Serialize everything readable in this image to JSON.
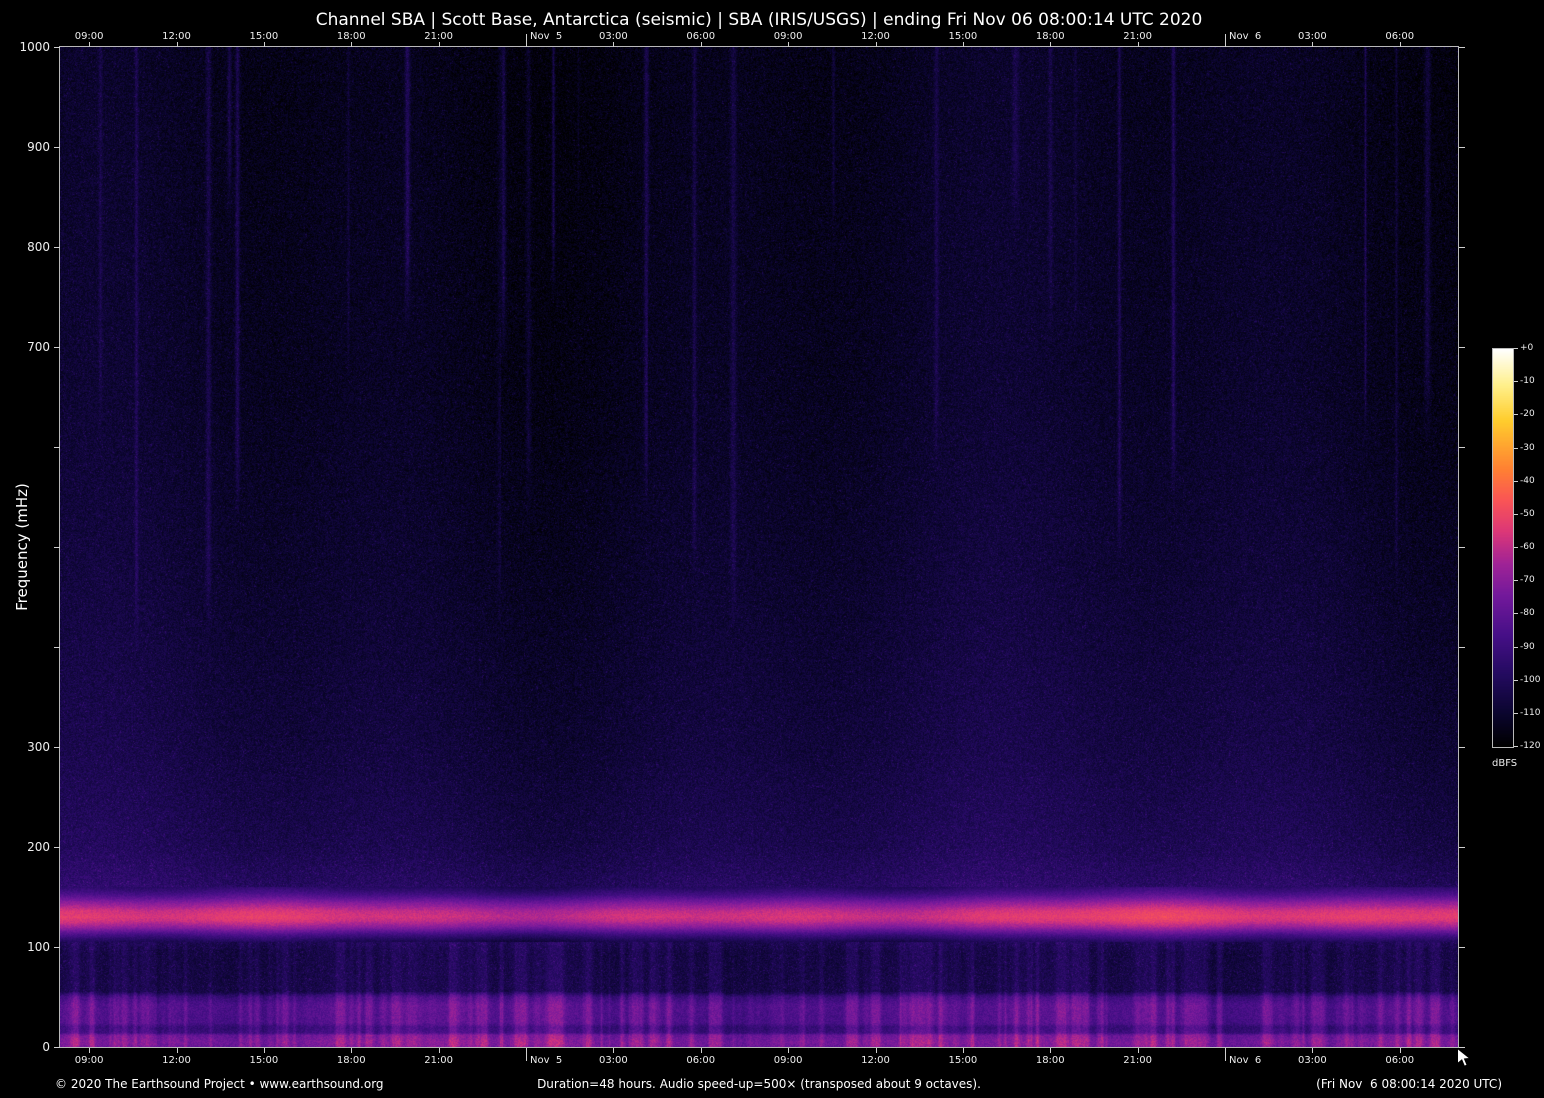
{
  "title": "Channel SBA | Scott Base, Antarctica (seismic) | SBA (IRIS/USGS) | ending Fri Nov 06 08:00:14 UTC 2020",
  "footer": {
    "copyright": "© 2020 The Earthsound Project • www.earthsound.org",
    "duration": "Duration=48 hours. Audio speed-up=500× (transposed about 9 octaves).",
    "timestamp": "(Fri Nov  6 08:00:14 2020 UTC)"
  },
  "colors": {
    "background": "#000000",
    "text": "#ffffff",
    "axis": "#c8c8c8"
  },
  "chart_data": {
    "type": "heatmap",
    "subtype": "audio-spectrogram",
    "title": "Channel SBA | Scott Base, Antarctica (seismic) | SBA (IRIS/USGS) | ending Fri Nov 06 08:00:14 UTC 2020",
    "xlabel": "",
    "ylabel": "Frequency (mHz)",
    "ylim": [
      0,
      1000
    ],
    "duration_hours": 48,
    "x_span_hours": 48,
    "x_ticks": [
      {
        "label": "09:00",
        "hour": 1
      },
      {
        "label": "12:00",
        "hour": 4
      },
      {
        "label": "15:00",
        "hour": 7
      },
      {
        "label": "18:00",
        "hour": 10
      },
      {
        "label": "21:00",
        "hour": 13
      },
      {
        "label": "Nov  5",
        "hour": 16,
        "date": true
      },
      {
        "label": "03:00",
        "hour": 19
      },
      {
        "label": "06:00",
        "hour": 22
      },
      {
        "label": "09:00",
        "hour": 25
      },
      {
        "label": "12:00",
        "hour": 28
      },
      {
        "label": "15:00",
        "hour": 31
      },
      {
        "label": "18:00",
        "hour": 34
      },
      {
        "label": "21:00",
        "hour": 37
      },
      {
        "label": "Nov  6",
        "hour": 40,
        "date": true
      },
      {
        "label": "03:00",
        "hour": 43
      },
      {
        "label": "06:00",
        "hour": 46
      }
    ],
    "y_ticks": [
      {
        "value": 1000,
        "label": "1000"
      },
      {
        "value": 900,
        "label": "900"
      },
      {
        "value": 800,
        "label": "800"
      },
      {
        "value": 700,
        "label": "700"
      },
      {
        "value": 600,
        "label": ""
      },
      {
        "value": 500,
        "label": ""
      },
      {
        "value": 400,
        "label": ""
      },
      {
        "value": 300,
        "label": "300"
      },
      {
        "value": 200,
        "label": "200"
      },
      {
        "value": 100,
        "label": "100"
      },
      {
        "value": 0,
        "label": "0"
      }
    ],
    "colorbar": {
      "unit": "dBFS",
      "max_dbfs": 0,
      "min_dbfs": -120,
      "tick_labels": [
        "+0",
        "-10",
        "-20",
        "-30",
        "-40",
        "-50",
        "-60",
        "-70",
        "-80",
        "-90",
        "-100",
        "-110",
        "-120"
      ],
      "gradient_stops": [
        {
          "v": 0.0,
          "c": "#000000"
        },
        {
          "v": 0.08,
          "c": "#0a052d"
        },
        {
          "v": 0.18,
          "c": "#230a5f"
        },
        {
          "v": 0.28,
          "c": "#460f87"
        },
        {
          "v": 0.38,
          "c": "#73199b"
        },
        {
          "v": 0.46,
          "c": "#a02396"
        },
        {
          "v": 0.54,
          "c": "#dc3778"
        },
        {
          "v": 0.62,
          "c": "#fa5555"
        },
        {
          "v": 0.7,
          "c": "#ff8232"
        },
        {
          "v": 0.82,
          "c": "#ffcd2d"
        },
        {
          "v": 0.91,
          "c": "#fff08c"
        },
        {
          "v": 1.0,
          "c": "#ffffff"
        }
      ]
    },
    "profile_dbfs": [
      [
        0,
        -76
      ],
      [
        5,
        -74
      ],
      [
        12,
        -78
      ],
      [
        14,
        -90
      ],
      [
        20,
        -92
      ],
      [
        24,
        -85
      ],
      [
        42,
        -84
      ],
      [
        50,
        -90
      ],
      [
        55,
        -104
      ],
      [
        95,
        -105
      ],
      [
        105,
        -102
      ],
      [
        112,
        -88
      ],
      [
        120,
        -68
      ],
      [
        126,
        -58
      ],
      [
        130,
        -55
      ],
      [
        136,
        -58
      ],
      [
        144,
        -70
      ],
      [
        152,
        -86
      ],
      [
        160,
        -97
      ],
      [
        200,
        -102
      ],
      [
        300,
        -106
      ],
      [
        450,
        -109
      ],
      [
        650,
        -112
      ],
      [
        1000,
        -114
      ]
    ],
    "features": {
      "bands": [
        {
          "freq_mhz": [
            110,
            160
          ],
          "peak_freq_mhz": 130,
          "approx_level_dbfs": -55,
          "description": "strong continuous microseism band (bright pink-red)"
        },
        {
          "freq_mhz": [
            55,
            105
          ],
          "approx_level_dbfs": -105,
          "description": "quiet dark blue band"
        },
        {
          "freq_mhz": [
            20,
            55
          ],
          "approx_level_dbfs": -85,
          "description": "purple low-frequency band with short vertical streaks"
        },
        {
          "freq_mhz": [
            0,
            14
          ],
          "approx_level_dbfs": -76,
          "description": "brighter magenta-purple band along bottom edge"
        },
        {
          "freq_mhz": [
            160,
            1000
          ],
          "approx_level_dbfs": -112,
          "description": "dark background with sparse blue speckle fading upward"
        }
      ],
      "transients": "faint narrow vertical blue streaks at irregular times extending from the top of the plot down to roughly 300-800 mHz"
    }
  }
}
